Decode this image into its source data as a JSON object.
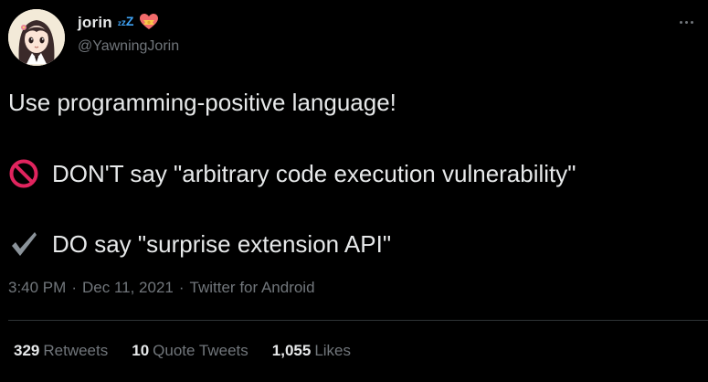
{
  "user": {
    "display_name": "jorin",
    "handle": "@YawningJorin",
    "name_emoji": [
      "zzz-icon",
      "heart-with-ribbon-icon"
    ]
  },
  "tweet": {
    "line1": "Use programming-positive language!",
    "line2": "DON'T say \"arbitrary code execution vulnerability\"",
    "line2_icon": "prohibited-icon",
    "line3": "DO say \"surprise extension API\"",
    "line3_icon": "check-mark-icon"
  },
  "meta": {
    "time": "3:40 PM",
    "separator": "·",
    "date": "Dec 11, 2021",
    "source": "Twitter for Android"
  },
  "stats": {
    "retweets_count": "329",
    "retweets_label": "Retweets",
    "quotes_count": "10",
    "quotes_label": "Quote Tweets",
    "likes_count": "1,055",
    "likes_label": "Likes"
  },
  "colors": {
    "background": "#000000",
    "text": "#e7e9ea",
    "muted": "#71767b",
    "divider": "#2f3336",
    "accent_blue": "#3fa3f5",
    "prohibited_red": "#e0245e"
  }
}
